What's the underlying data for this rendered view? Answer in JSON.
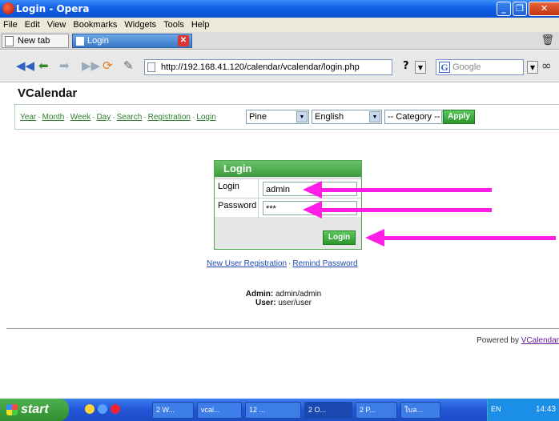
{
  "window": {
    "title": "Login - Opera",
    "controls": [
      "_",
      "❐",
      "✕"
    ]
  },
  "menu": [
    "File",
    "Edit",
    "View",
    "Bookmarks",
    "Widgets",
    "Tools",
    "Help"
  ],
  "tabs": [
    {
      "label": "New tab",
      "active": false
    },
    {
      "label": "Login",
      "active": true
    }
  ],
  "navbar": {
    "url": "http://192.168.41.120/calendar/vcalendar/login.php",
    "help": "?",
    "search_placeholder": "Google",
    "search_engine": "G"
  },
  "page": {
    "title": "VCalendar",
    "nav_links": [
      "Year",
      "Month",
      "Week",
      "Day",
      "Search",
      "Registration",
      "Login"
    ],
    "style_select": "Pine",
    "language_select": "English",
    "category_select": "-- Category --",
    "apply_label": "Apply",
    "login_box": {
      "header": "Login",
      "login_label": "Login",
      "login_value": "admin",
      "password_label": "Password",
      "password_value": "***",
      "button_label": "Login"
    },
    "register_link": "New User Registration",
    "remind_link": "Remind Password",
    "admin_label": "Admin:",
    "admin_value": "admin/admin",
    "user_label": "User:",
    "user_value": "user/user",
    "powered_text": "Powered by",
    "powered_link": "VCalendar"
  },
  "taskbar": {
    "start_label": "start",
    "buttons": [
      "2 W...",
      "vcal...",
      "12 ...",
      "2 O...",
      "2 P...",
      "ใบล..."
    ],
    "lang": "EN",
    "clock": "14:43"
  },
  "colors": {
    "accent_green": "#3b9a3b",
    "arrow_pink": "#ff1ee6",
    "link_green": "#2f7f2f"
  }
}
